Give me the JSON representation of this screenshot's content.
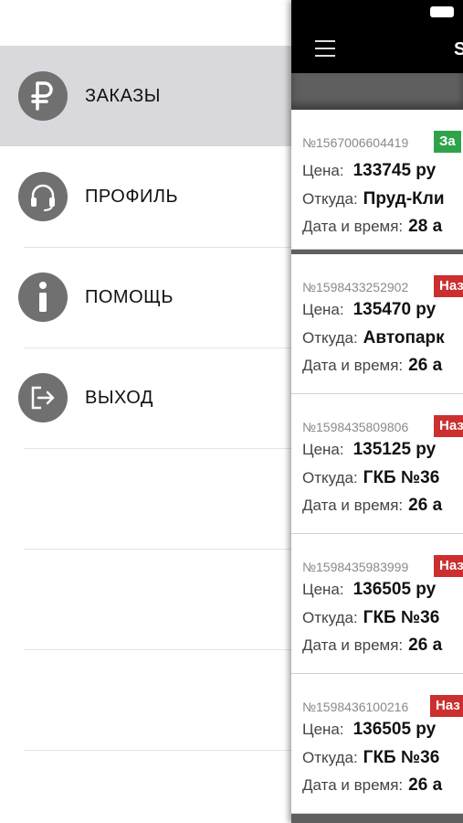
{
  "menu": {
    "items": [
      {
        "label": "ЗАКАЗЫ",
        "icon": "ruble-icon"
      },
      {
        "label": "ПРОФИЛЬ",
        "icon": "headset-icon"
      },
      {
        "label": "ПОМОЩЬ",
        "icon": "info-icon"
      },
      {
        "label": "ВЫХОД",
        "icon": "logout-icon"
      }
    ]
  },
  "header": {
    "title": "S"
  },
  "labels": {
    "price": "Цена:",
    "from": "Откуда:",
    "datetime": "Дата и время:"
  },
  "orders": [
    {
      "number": "№1567006604419",
      "status": "За",
      "price": "133745 ру",
      "from": "Пруд-Кли",
      "datetime": "28 а"
    },
    {
      "number": "№1598433252902",
      "status": "Наз",
      "price": "135470 ру",
      "from": "Автопарк",
      "datetime": "26 а"
    },
    {
      "number": "№1598435809806",
      "status": "Наз",
      "price": "135125 ру",
      "from": "ГКБ №36",
      "datetime": "26 а"
    },
    {
      "number": "№1598435983999",
      "status": "Наз",
      "price": "136505 ру",
      "from": "ГКБ №36",
      "datetime": "26 а"
    },
    {
      "number": "№1598436100216",
      "status": "Наз",
      "price": "136505 ру",
      "from": "ГКБ №36",
      "datetime": "26 а"
    }
  ],
  "colors": {
    "status_green": "#2fa34a",
    "status_red": "#cc2f2f",
    "menu_active": "#d9d8dc"
  }
}
